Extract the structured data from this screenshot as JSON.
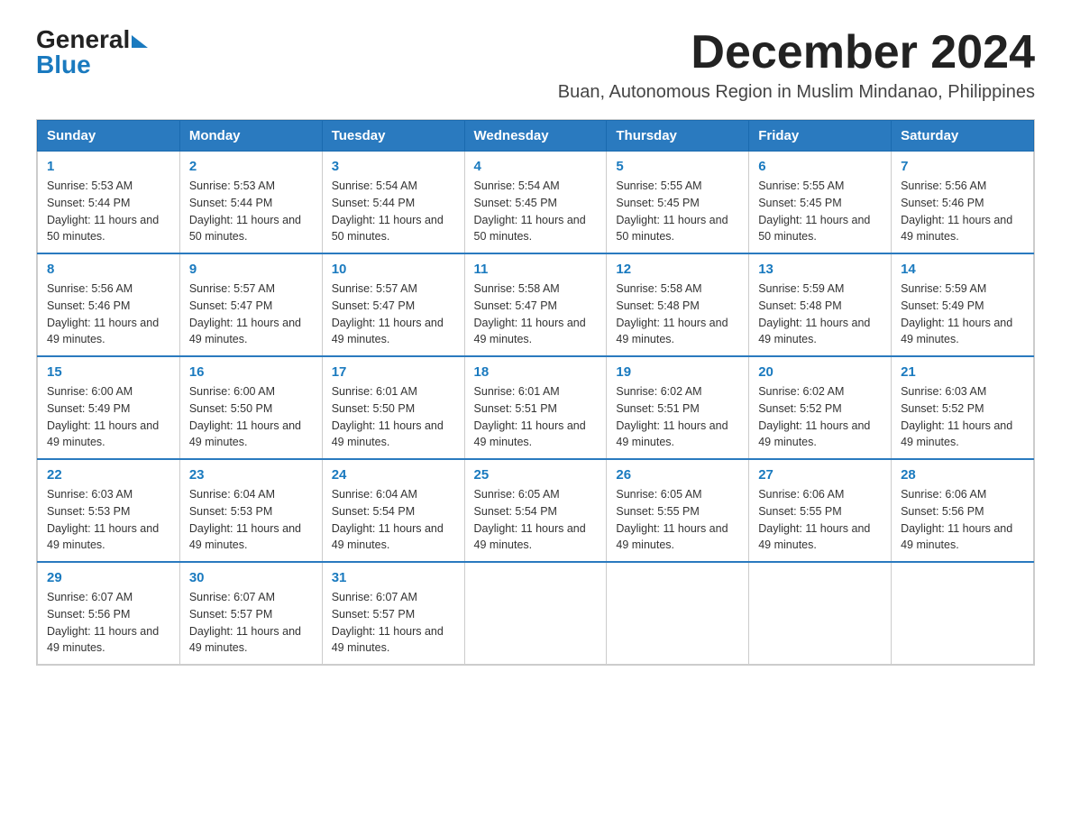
{
  "logo": {
    "general": "General",
    "blue": "Blue"
  },
  "title": "December 2024",
  "subtitle": "Buan, Autonomous Region in Muslim Mindanao, Philippines",
  "days_of_week": [
    "Sunday",
    "Monday",
    "Tuesday",
    "Wednesday",
    "Thursday",
    "Friday",
    "Saturday"
  ],
  "weeks": [
    [
      {
        "day": "1",
        "sunrise": "5:53 AM",
        "sunset": "5:44 PM",
        "daylight": "11 hours and 50 minutes."
      },
      {
        "day": "2",
        "sunrise": "5:53 AM",
        "sunset": "5:44 PM",
        "daylight": "11 hours and 50 minutes."
      },
      {
        "day": "3",
        "sunrise": "5:54 AM",
        "sunset": "5:44 PM",
        "daylight": "11 hours and 50 minutes."
      },
      {
        "day": "4",
        "sunrise": "5:54 AM",
        "sunset": "5:45 PM",
        "daylight": "11 hours and 50 minutes."
      },
      {
        "day": "5",
        "sunrise": "5:55 AM",
        "sunset": "5:45 PM",
        "daylight": "11 hours and 50 minutes."
      },
      {
        "day": "6",
        "sunrise": "5:55 AM",
        "sunset": "5:45 PM",
        "daylight": "11 hours and 50 minutes."
      },
      {
        "day": "7",
        "sunrise": "5:56 AM",
        "sunset": "5:46 PM",
        "daylight": "11 hours and 49 minutes."
      }
    ],
    [
      {
        "day": "8",
        "sunrise": "5:56 AM",
        "sunset": "5:46 PM",
        "daylight": "11 hours and 49 minutes."
      },
      {
        "day": "9",
        "sunrise": "5:57 AM",
        "sunset": "5:47 PM",
        "daylight": "11 hours and 49 minutes."
      },
      {
        "day": "10",
        "sunrise": "5:57 AM",
        "sunset": "5:47 PM",
        "daylight": "11 hours and 49 minutes."
      },
      {
        "day": "11",
        "sunrise": "5:58 AM",
        "sunset": "5:47 PM",
        "daylight": "11 hours and 49 minutes."
      },
      {
        "day": "12",
        "sunrise": "5:58 AM",
        "sunset": "5:48 PM",
        "daylight": "11 hours and 49 minutes."
      },
      {
        "day": "13",
        "sunrise": "5:59 AM",
        "sunset": "5:48 PM",
        "daylight": "11 hours and 49 minutes."
      },
      {
        "day": "14",
        "sunrise": "5:59 AM",
        "sunset": "5:49 PM",
        "daylight": "11 hours and 49 minutes."
      }
    ],
    [
      {
        "day": "15",
        "sunrise": "6:00 AM",
        "sunset": "5:49 PM",
        "daylight": "11 hours and 49 minutes."
      },
      {
        "day": "16",
        "sunrise": "6:00 AM",
        "sunset": "5:50 PM",
        "daylight": "11 hours and 49 minutes."
      },
      {
        "day": "17",
        "sunrise": "6:01 AM",
        "sunset": "5:50 PM",
        "daylight": "11 hours and 49 minutes."
      },
      {
        "day": "18",
        "sunrise": "6:01 AM",
        "sunset": "5:51 PM",
        "daylight": "11 hours and 49 minutes."
      },
      {
        "day": "19",
        "sunrise": "6:02 AM",
        "sunset": "5:51 PM",
        "daylight": "11 hours and 49 minutes."
      },
      {
        "day": "20",
        "sunrise": "6:02 AM",
        "sunset": "5:52 PM",
        "daylight": "11 hours and 49 minutes."
      },
      {
        "day": "21",
        "sunrise": "6:03 AM",
        "sunset": "5:52 PM",
        "daylight": "11 hours and 49 minutes."
      }
    ],
    [
      {
        "day": "22",
        "sunrise": "6:03 AM",
        "sunset": "5:53 PM",
        "daylight": "11 hours and 49 minutes."
      },
      {
        "day": "23",
        "sunrise": "6:04 AM",
        "sunset": "5:53 PM",
        "daylight": "11 hours and 49 minutes."
      },
      {
        "day": "24",
        "sunrise": "6:04 AM",
        "sunset": "5:54 PM",
        "daylight": "11 hours and 49 minutes."
      },
      {
        "day": "25",
        "sunrise": "6:05 AM",
        "sunset": "5:54 PM",
        "daylight": "11 hours and 49 minutes."
      },
      {
        "day": "26",
        "sunrise": "6:05 AM",
        "sunset": "5:55 PM",
        "daylight": "11 hours and 49 minutes."
      },
      {
        "day": "27",
        "sunrise": "6:06 AM",
        "sunset": "5:55 PM",
        "daylight": "11 hours and 49 minutes."
      },
      {
        "day": "28",
        "sunrise": "6:06 AM",
        "sunset": "5:56 PM",
        "daylight": "11 hours and 49 minutes."
      }
    ],
    [
      {
        "day": "29",
        "sunrise": "6:07 AM",
        "sunset": "5:56 PM",
        "daylight": "11 hours and 49 minutes."
      },
      {
        "day": "30",
        "sunrise": "6:07 AM",
        "sunset": "5:57 PM",
        "daylight": "11 hours and 49 minutes."
      },
      {
        "day": "31",
        "sunrise": "6:07 AM",
        "sunset": "5:57 PM",
        "daylight": "11 hours and 49 minutes."
      },
      null,
      null,
      null,
      null
    ]
  ],
  "labels": {
    "sunrise": "Sunrise:",
    "sunset": "Sunset:",
    "daylight": "Daylight:"
  }
}
